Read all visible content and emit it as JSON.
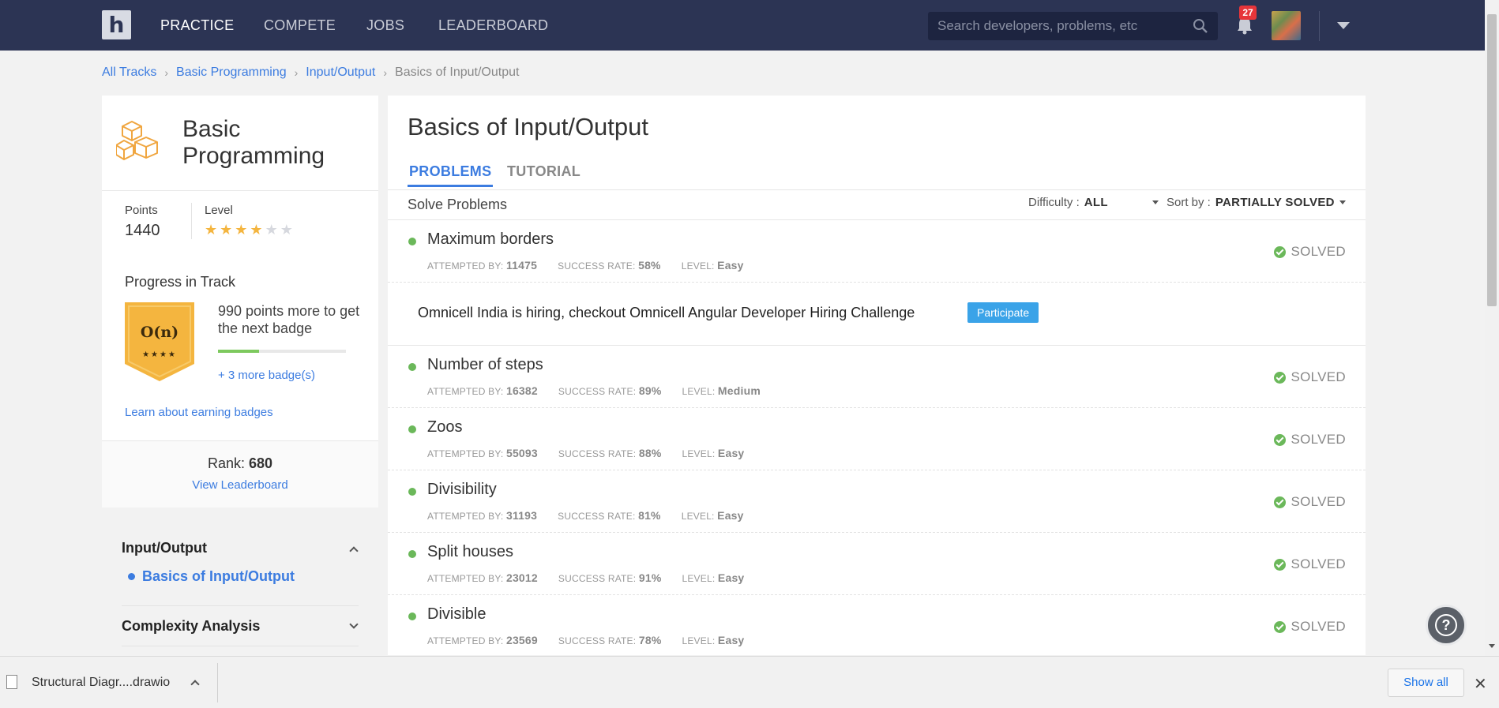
{
  "nav": {
    "logo": "h",
    "links": [
      "PRACTICE",
      "COMPETE",
      "JOBS",
      "LEADERBOARD"
    ],
    "active_link": "PRACTICE",
    "search_placeholder": "Search developers, problems, etc",
    "notification_count": "27"
  },
  "breadcrumb": [
    "All Tracks",
    "Basic Programming",
    "Input/Output",
    "Basics of Input/Output"
  ],
  "track": {
    "title": "Basic Programming",
    "points_label": "Points",
    "points_value": "1440",
    "level_label": "Level",
    "level_stars": 4,
    "level_max": 6,
    "progress_title": "Progress in Track",
    "badge_text": "O(n)",
    "badge_stars": "★★★★",
    "next_badge_text": "990 points more to get the next badge",
    "progress_fraction": 0.32,
    "more_badges": "+ 3 more badge(s)",
    "learn_link": "Learn about earning badges",
    "rank_label": "Rank:",
    "rank_value": "680",
    "view_leaderboard": "View Leaderboard"
  },
  "sidebar": {
    "section1": "Input/Output",
    "section1_item": "Basics of Input/Output",
    "section2": "Complexity Analysis"
  },
  "main": {
    "title": "Basics of Input/Output",
    "tabs": [
      "PROBLEMS",
      "TUTORIAL"
    ],
    "solve_label": "Solve Problems",
    "difficulty_label": "Difficulty :",
    "difficulty_value": "ALL",
    "sort_label": "Sort by :",
    "sort_value": "PARTIALLY SOLVED",
    "hiring_text": "Omnicell India is hiring, checkout Omnicell Angular Developer Hiring Challenge",
    "participate": "Participate",
    "meta_labels": {
      "attempted": "ATTEMPTED BY:",
      "success": "SUCCESS RATE:",
      "level": "LEVEL:"
    },
    "status_label": "SOLVED",
    "problems": [
      {
        "name": "Maximum borders",
        "attempted": "11475",
        "success": "58%",
        "level": "Easy"
      },
      {
        "name": "Number of steps",
        "attempted": "16382",
        "success": "89%",
        "level": "Medium"
      },
      {
        "name": "Zoos",
        "attempted": "55093",
        "success": "88%",
        "level": "Easy"
      },
      {
        "name": "Divisibility",
        "attempted": "31193",
        "success": "81%",
        "level": "Easy"
      },
      {
        "name": "Split houses",
        "attempted": "23012",
        "success": "91%",
        "level": "Easy"
      },
      {
        "name": "Divisible",
        "attempted": "23569",
        "success": "78%",
        "level": "Easy"
      }
    ]
  },
  "help_symbol": "?",
  "download_bar": {
    "file_name": "Structural Diagr....drawio",
    "show_all": "Show all",
    "close": "✕"
  },
  "colors": {
    "nav_bg": "#2c3454",
    "accent_blue": "#3c7ce0",
    "solved_green": "#6bb85a",
    "badge_gold": "#f4b53f"
  }
}
